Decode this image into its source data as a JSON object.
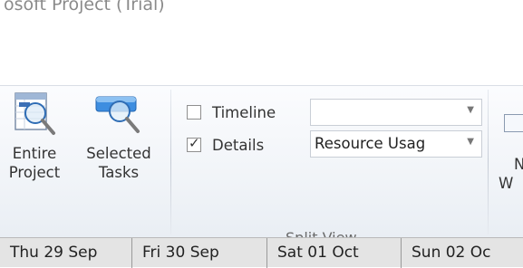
{
  "title": "osoft Project (Trial)",
  "ribbon": {
    "entire_project": {
      "line1": "Entire",
      "line2": "Project",
      "icon": "entire-project-zoom-icon"
    },
    "selected_tasks": {
      "line1": "Selected",
      "line2": "Tasks",
      "icon": "selected-tasks-zoom-icon"
    },
    "split_view": {
      "timeline": {
        "label": "Timeline",
        "checked": false,
        "combo_value": ""
      },
      "details": {
        "label": "Details",
        "checked": true,
        "combo_value": "Resource Usag"
      },
      "group_label": "Split View"
    },
    "partial_next": {
      "line1": "N",
      "line2": "W"
    }
  },
  "timescale": [
    "Thu 29 Sep",
    "Fri 30 Sep",
    "Sat 01 Oct",
    "Sun 02 Oc"
  ],
  "colors": {
    "ribbon_bg": "#f1f4f8",
    "timescale_bg": "#e4e4e4",
    "icon_blue": "#4a90d9"
  }
}
